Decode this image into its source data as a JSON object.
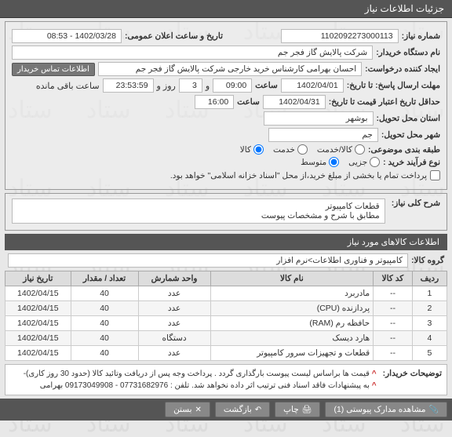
{
  "titleBar": "جزئیات اطلاعات نیاز",
  "fields": {
    "reqNumLabel": "شماره نیاز:",
    "reqNum": "1102092273000113",
    "annDateLabel": "تاریخ و ساعت اعلان عمومی:",
    "annDate": "1402/03/28 - 08:53",
    "buyerOrgLabel": "نام دستگاه خریدار:",
    "buyerOrg": "شرکت پالایش گاز فجر جم",
    "creatorLabel": "ایجاد کننده درخواست:",
    "creator": "احسان بهرامی کارشناس خرید خارجی شرکت پالایش گاز فجر جم",
    "contactBtn": "اطلاعات تماس خریدار",
    "deadlineLabel": "مهلت ارسال پاسخ: تا تاریخ:",
    "deadlineDate": "1402/04/01",
    "timeLbl": "ساعت",
    "deadlineTime": "09:00",
    "andLbl": "و",
    "daysLeft": "3",
    "daysLeftLbl": "روز و",
    "timeLeft": "23:53:59",
    "timeLeftLbl": "ساعت باقی مانده",
    "validLabel": "حداقل تاریخ اعتبار قیمت تا تاریخ:",
    "validDate": "1402/04/31",
    "validTime": "16:00",
    "provinceLabel": "استان محل تحویل:",
    "province": "بوشهر",
    "cityLabel": "شهر محل تحویل:",
    "city": "جم",
    "subjectCatLabel": "طبقه بندی موضوعی:",
    "catOptions": {
      "goods": "کالا/خدمت",
      "service": "خدمت",
      "goodsOnly": "کالا"
    },
    "procTypeLabel": "نوع فرآیند خرید :",
    "procOptions": {
      "small": "جزیی",
      "medium": "متوسط"
    },
    "partialPayLabel": "پرداخت تمام یا بخشی از مبلغ خرید،از محل \"اسناد خزانه اسلامی\" خواهد بود."
  },
  "descTitle": "شرح کلی نیاز:",
  "descText1": "قطعات کامپیوتر",
  "descText2": "مطابق با شرح و مشخصات پیوست",
  "itemsHeader": "اطلاعات کالاهای مورد نیاز",
  "groupLabel": "گروه کالا:",
  "groupValue": "کامپیوتر و فناوری اطلاعات>نرم افزار",
  "table": {
    "headers": [
      "ردیف",
      "کد کالا",
      "نام کالا",
      "واحد شمارش",
      "تعداد / مقدار",
      "تاریخ نیاز"
    ],
    "rows": [
      [
        "1",
        "--",
        "مادربرد",
        "عدد",
        "40",
        "1402/04/15"
      ],
      [
        "2",
        "--",
        "پردازنده (CPU)",
        "عدد",
        "40",
        "1402/04/15"
      ],
      [
        "3",
        "--",
        "حافظه رم (RAM)",
        "عدد",
        "40",
        "1402/04/15"
      ],
      [
        "4",
        "--",
        "هارد دیسک",
        "دستگاه",
        "40",
        "1402/04/15"
      ],
      [
        "5",
        "--",
        "قطعات و تجهیزات سرور کامپیوتر",
        "عدد",
        "40",
        "1402/04/15"
      ]
    ]
  },
  "buyerDescLabel": "توضیحات خریدار:",
  "buyerDesc1": "قیمت ها براساس لیست پیوست بارگذاری گردد . پرداخت وجه پس از دریافت وتائید کالا (حدود 30 روز کاری)-",
  "buyerDesc2": "به پیشنهادات فاقد اسناد فنی ترتیب اثر داده نخواهد شد. تلفن : 07731682976 - 09173049908 بهرامی",
  "bullet": "^",
  "bottom": {
    "attachments": "مشاهده مدارک پیوستی (1)",
    "print": "چاپ",
    "back": "بازگشت",
    "close": "بستن"
  }
}
